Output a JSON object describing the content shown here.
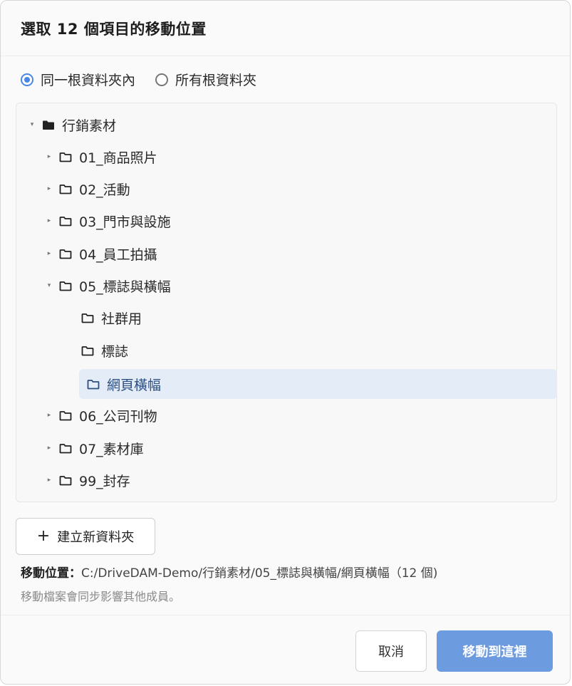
{
  "dialog": {
    "title": "選取 12 個項目的移動位置"
  },
  "scope": {
    "options": [
      {
        "label": "同一根資料夾內",
        "checked": true
      },
      {
        "label": "所有根資料夾",
        "checked": false
      }
    ]
  },
  "tree": {
    "root": {
      "label": "行銷素材",
      "expanded": true,
      "icon": "folder-filled-icon"
    },
    "items": [
      {
        "label": "01_商品照片",
        "caret": "▸",
        "icon": "folder-outline-icon"
      },
      {
        "label": "02_活動",
        "caret": "▸",
        "icon": "folder-outline-icon"
      },
      {
        "label": "03_門市與設施",
        "caret": "▸",
        "icon": "folder-outline-icon"
      },
      {
        "label": "04_員工拍攝",
        "caret": "▸",
        "icon": "folder-outline-icon"
      },
      {
        "label": "05_標誌與橫幅",
        "caret": "▾",
        "icon": "folder-outline-icon"
      },
      {
        "label": "社群用",
        "caret": "",
        "icon": "folder-outline-icon"
      },
      {
        "label": "標誌",
        "caret": "",
        "icon": "folder-outline-icon"
      },
      {
        "label": "網頁橫幅",
        "caret": "",
        "icon": "folder-outline-icon",
        "selected": true
      },
      {
        "label": "06_公司刊物",
        "caret": "▸",
        "icon": "folder-outline-icon"
      },
      {
        "label": "07_素材庫",
        "caret": "▸",
        "icon": "folder-outline-icon"
      },
      {
        "label": "99_封存",
        "caret": "▸",
        "icon": "folder-outline-icon"
      }
    ]
  },
  "new_folder_button": {
    "icon": "plus-icon",
    "label": "建立新資料夾"
  },
  "destination": {
    "label": "移動位置：",
    "path": "C:/DriveDAM-Demo/行銷素材/05_標誌與橫幅/網頁橫幅（12 個)"
  },
  "note": "移動檔案會同步影響其他成員。",
  "footer": {
    "cancel_label": "取消",
    "confirm_label": "移動到這裡"
  },
  "colors": {
    "accent": "#4a86e8",
    "primary_button": "#6d9be0",
    "selected_row": "#e4ecf7"
  }
}
